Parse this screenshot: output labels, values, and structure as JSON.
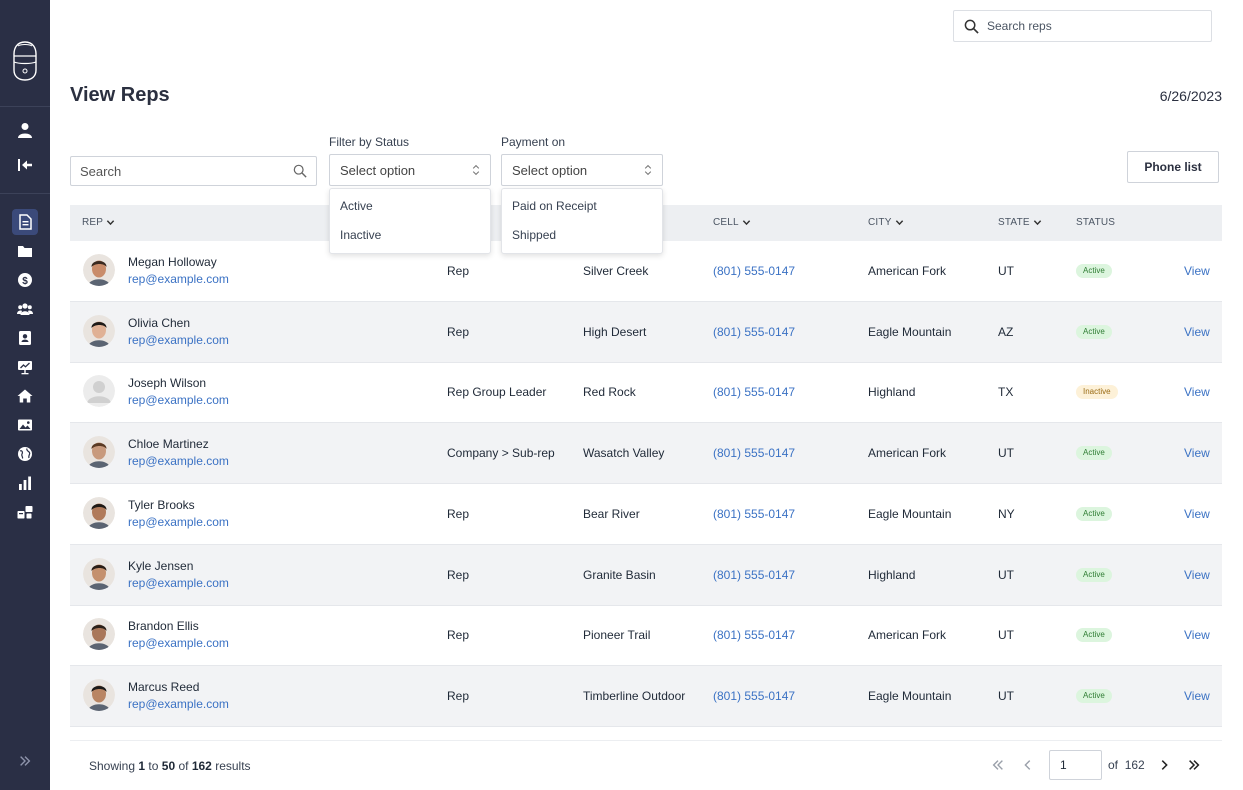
{
  "header": {
    "search_placeholder": "Search reps",
    "title": "View Reps",
    "date": "6/26/2023"
  },
  "filters": {
    "search_placeholder": "Search",
    "status_label": "Filter by Status",
    "status_value": "Select option",
    "status_options": [
      "Active",
      "Inactive"
    ],
    "payment_label": "Payment on",
    "payment_value": "Select option",
    "payment_options": [
      "Paid on Receipt",
      "Shipped"
    ],
    "phone_list_label": "Phone list"
  },
  "table": {
    "headers": {
      "rep": "REP",
      "cell": "CELL",
      "city": "CITY",
      "state": "STATE",
      "status": "STATUS"
    },
    "view_label": "View",
    "rows": [
      {
        "name": "Megan Holloway",
        "email": "rep@example.com",
        "role": "Rep",
        "territory": "Silver Creek",
        "cell": "(801) 555-0147",
        "city": "American Fork",
        "state": "UT",
        "status": "Active"
      },
      {
        "name": "Olivia Chen",
        "email": "rep@example.com",
        "role": "Rep",
        "territory": "High Desert",
        "cell": "(801) 555-0147",
        "city": "Eagle Mountain",
        "state": "AZ",
        "status": "Active"
      },
      {
        "name": "Joseph Wilson",
        "email": "rep@example.com",
        "role": "Rep Group Leader",
        "territory": "Red Rock",
        "cell": "(801) 555-0147",
        "city": "Highland",
        "state": "TX",
        "status": "Inactive"
      },
      {
        "name": "Chloe Martinez",
        "email": "rep@example.com",
        "role": "Company > Sub-rep",
        "territory": "Wasatch Valley",
        "cell": "(801) 555-0147",
        "city": "American Fork",
        "state": "UT",
        "status": "Active"
      },
      {
        "name": "Tyler Brooks",
        "email": "rep@example.com",
        "role": "Rep",
        "territory": "Bear River",
        "cell": "(801) 555-0147",
        "city": "Eagle Mountain",
        "state": "NY",
        "status": "Active"
      },
      {
        "name": "Kyle Jensen",
        "email": "rep@example.com",
        "role": "Rep",
        "territory": "Granite Basin",
        "cell": "(801) 555-0147",
        "city": "Highland",
        "state": "UT",
        "status": "Active"
      },
      {
        "name": "Brandon Ellis",
        "email": "rep@example.com",
        "role": "Rep",
        "territory": "Pioneer Trail",
        "cell": "(801) 555-0147",
        "city": "American Fork",
        "state": "UT",
        "status": "Active"
      },
      {
        "name": "Marcus Reed",
        "email": "rep@example.com",
        "role": "Rep",
        "territory": "Timberline Outdoor",
        "cell": "(801) 555-0147",
        "city": "Eagle Mountain",
        "state": "UT",
        "status": "Active"
      }
    ]
  },
  "footer": {
    "showing_prefix": "Showing",
    "range_start": "1",
    "to": "to",
    "range_end": "50",
    "of": "of",
    "total": "162",
    "results": "results",
    "page_value": "1",
    "page_of": "of",
    "page_total": "162"
  },
  "colors": {
    "sidebar": "#2a2f45",
    "link": "#3b72c4",
    "active_badge": "#dcf5de",
    "inactive_badge": "#fdf1d8"
  },
  "icons": {
    "sidebar": [
      "user-icon",
      "collapse-icon",
      "document-icon",
      "folder-icon",
      "dollar-icon",
      "users-icon",
      "contact-icon",
      "presentation-icon",
      "home-icon",
      "image-icon",
      "globe-icon",
      "bar-chart-icon",
      "widgets-icon"
    ]
  }
}
